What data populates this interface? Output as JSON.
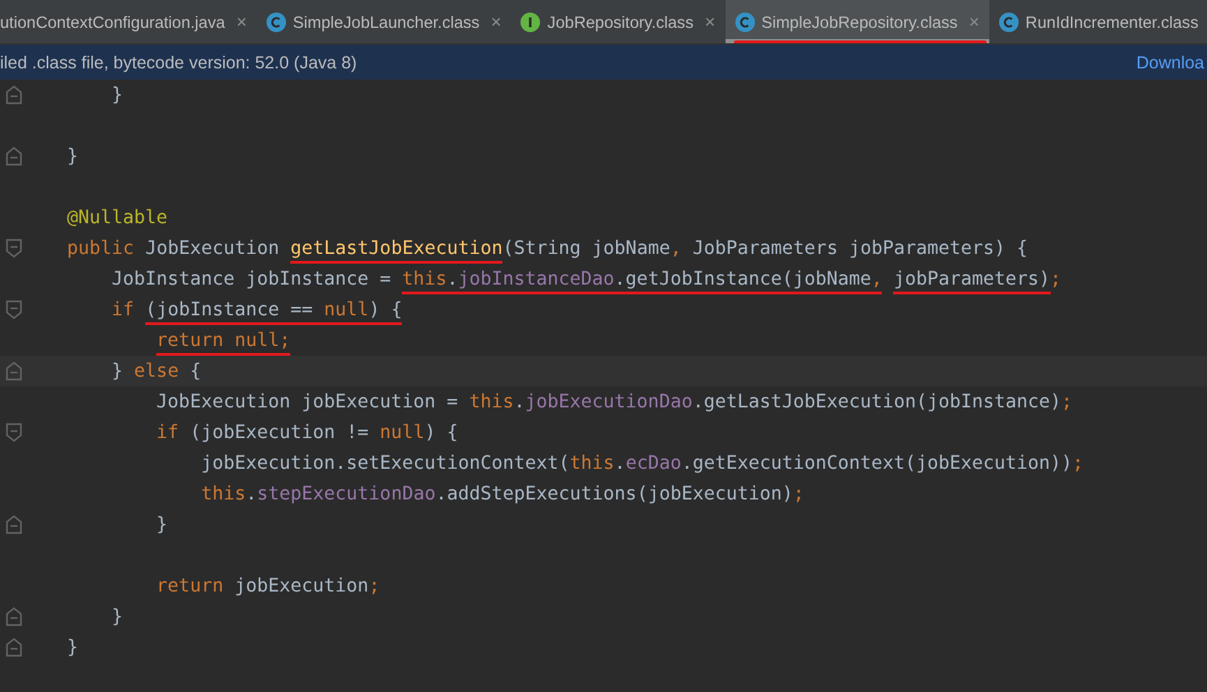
{
  "tabs": [
    {
      "label": "utionContextConfiguration.java",
      "selected": false,
      "closable": true
    },
    {
      "label": "SimpleJobLauncher.class",
      "kind": "class",
      "selected": false,
      "closable": true
    },
    {
      "label": "JobRepository.class",
      "kind": "interface",
      "selected": false,
      "closable": true
    },
    {
      "label": "SimpleJobRepository.class",
      "kind": "class",
      "selected": true,
      "closable": true,
      "marked": true
    },
    {
      "label": "RunIdIncrementer.class",
      "kind": "class",
      "selected": false,
      "closable": false
    }
  ],
  "close_glyph": "×",
  "banner": {
    "text": "iled .class file, bytecode version: 52.0 (Java 8)",
    "link": "Downloa"
  },
  "lines": [
    {
      "kind": "code",
      "fold_close": true,
      "segments": [
        {
          "kind": "plain",
          "text": "    }"
        }
      ]
    },
    {
      "kind": "blank"
    },
    {
      "kind": "code",
      "fold_close": true,
      "segments": [
        {
          "kind": "plain",
          "text": "}"
        }
      ]
    },
    {
      "kind": "blank"
    },
    {
      "kind": "code",
      "segments": [
        {
          "kind": "annotation",
          "text": "@Nullable"
        }
      ]
    },
    {
      "kind": "code",
      "fold_open": true,
      "segments": [
        {
          "kind": "keyword",
          "text": "public"
        },
        {
          "kind": "plain",
          "text": " JobExecution "
        },
        {
          "kind": "method",
          "text": "getLastJobExecution",
          "marked": true
        },
        {
          "kind": "plain",
          "text": "(String jobName"
        },
        {
          "kind": "keyword",
          "text": ","
        },
        {
          "kind": "plain",
          "text": " JobParameters jobParameters) {"
        }
      ]
    },
    {
      "kind": "code",
      "segments": [
        {
          "kind": "plain",
          "text": "    JobInstance jobInstance = "
        },
        {
          "kind": "keyword",
          "text": "this",
          "marked": true
        },
        {
          "kind": "plain",
          "text": ".",
          "marked": true
        },
        {
          "kind": "field",
          "text": "jobInstanceDao",
          "marked": true
        },
        {
          "kind": "plain",
          "text": ".getJobInstance(jobName",
          "marked": true
        },
        {
          "kind": "keyword",
          "text": ",",
          "marked": true
        },
        {
          "kind": "plain",
          "text": " jobParameters)",
          "marked": true
        },
        {
          "kind": "keyword",
          "text": ";"
        }
      ]
    },
    {
      "kind": "code",
      "fold_open": true,
      "segments": [
        {
          "kind": "keyword",
          "text": "    if"
        },
        {
          "kind": "plain",
          "text": " (jobInstance == ",
          "marked": true
        },
        {
          "kind": "keyword",
          "text": "null",
          "marked": true
        },
        {
          "kind": "plain",
          "text": ") {",
          "marked": true
        }
      ]
    },
    {
      "kind": "code",
      "segments": [
        {
          "kind": "keyword",
          "text": "        return null;",
          "marked": true
        }
      ]
    },
    {
      "kind": "code",
      "fold_close": true,
      "current": true,
      "segments": [
        {
          "kind": "plain",
          "text": "    } "
        },
        {
          "kind": "keyword",
          "text": "else"
        },
        {
          "kind": "plain",
          "text": " {"
        }
      ]
    },
    {
      "kind": "code",
      "segments": [
        {
          "kind": "plain",
          "text": "        JobExecution jobExecution = "
        },
        {
          "kind": "keyword",
          "text": "this"
        },
        {
          "kind": "plain",
          "text": "."
        },
        {
          "kind": "field",
          "text": "jobExecutionDao"
        },
        {
          "kind": "plain",
          "text": ".getLastJobExecution(jobInstance)"
        },
        {
          "kind": "keyword",
          "text": ";"
        }
      ]
    },
    {
      "kind": "code",
      "fold_open": true,
      "segments": [
        {
          "kind": "keyword",
          "text": "        if"
        },
        {
          "kind": "plain",
          "text": " (jobExecution != "
        },
        {
          "kind": "keyword",
          "text": "null"
        },
        {
          "kind": "plain",
          "text": ") {"
        }
      ]
    },
    {
      "kind": "code",
      "segments": [
        {
          "kind": "plain",
          "text": "            jobExecution.setExecutionContext("
        },
        {
          "kind": "keyword",
          "text": "this"
        },
        {
          "kind": "plain",
          "text": "."
        },
        {
          "kind": "field",
          "text": "ecDao"
        },
        {
          "kind": "plain",
          "text": ".getExecutionContext(jobExecution))"
        },
        {
          "kind": "keyword",
          "text": ";"
        }
      ]
    },
    {
      "kind": "code",
      "segments": [
        {
          "kind": "keyword",
          "text": "            this"
        },
        {
          "kind": "plain",
          "text": "."
        },
        {
          "kind": "field",
          "text": "stepExecutionDao"
        },
        {
          "kind": "plain",
          "text": ".addStepExecutions(jobExecution)"
        },
        {
          "kind": "keyword",
          "text": ";"
        }
      ]
    },
    {
      "kind": "code",
      "fold_close": true,
      "segments": [
        {
          "kind": "plain",
          "text": "        }"
        }
      ]
    },
    {
      "kind": "blank"
    },
    {
      "kind": "code",
      "segments": [
        {
          "kind": "keyword",
          "text": "        return"
        },
        {
          "kind": "plain",
          "text": " jobExecution"
        },
        {
          "kind": "keyword",
          "text": ";"
        }
      ]
    },
    {
      "kind": "code",
      "fold_close": true,
      "segments": [
        {
          "kind": "plain",
          "text": "    }"
        }
      ]
    },
    {
      "kind": "code",
      "fold_close": true,
      "segments": [
        {
          "kind": "plain",
          "text": "}"
        }
      ]
    }
  ]
}
